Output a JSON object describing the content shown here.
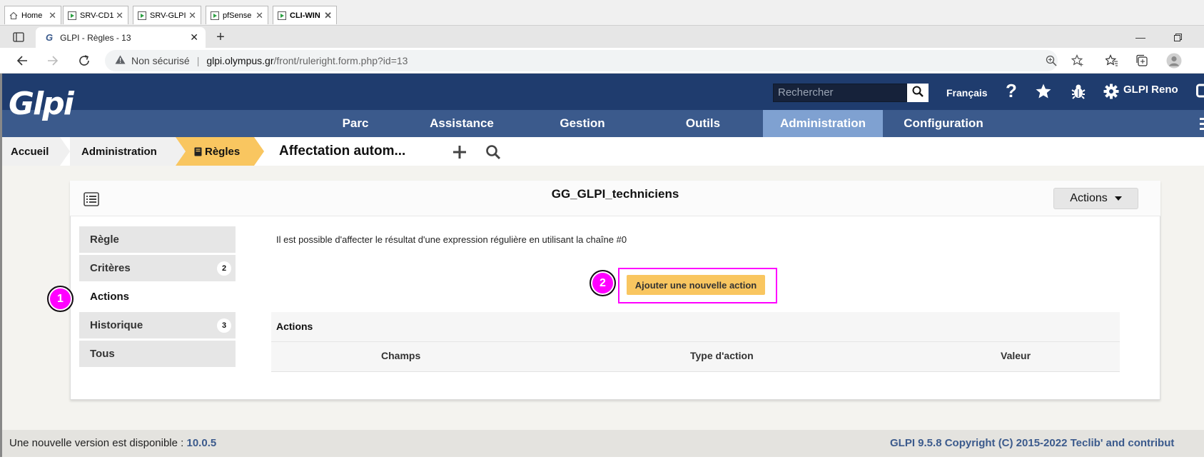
{
  "vm_tabs": [
    {
      "label": "Home",
      "icon": "home-icon"
    },
    {
      "label": "SRV-CD1",
      "icon": "vm-icon"
    },
    {
      "label": "SRV-GLPI",
      "icon": "vm-icon"
    },
    {
      "label": "pfSense",
      "icon": "vm-icon"
    },
    {
      "label": "CLI-WIN",
      "icon": "vm-icon",
      "active": true
    }
  ],
  "browser": {
    "tab_title": "GLPI - Règles - 13",
    "address": {
      "security_label": "Non sécurisé",
      "host": "glpi.olympus.gr",
      "path": "/front/ruleright.form.php?id=13"
    }
  },
  "glpi": {
    "logo": "Glpi",
    "search_placeholder": "Rechercher",
    "language": "Français",
    "user": "GLPI Reno",
    "nav": [
      "Parc",
      "Assistance",
      "Gestion",
      "Outils",
      "Administration",
      "Configuration"
    ],
    "active_nav": "Administration",
    "breadcrumb": [
      "Accueil",
      "Administration",
      "Règles"
    ],
    "page_title": "Affectation autom...",
    "colors": {
      "header_dark": "#1f3c6e",
      "nav": "#3b5a8c",
      "nav_active": "#7fa1d1",
      "crumb_active": "#f9c660",
      "highlight": "#ff00ff"
    }
  },
  "card": {
    "title": "GG_GLPI_techniciens",
    "actions_label": "Actions",
    "side_tabs": [
      {
        "label": "Règle"
      },
      {
        "label": "Critères",
        "count": "2"
      },
      {
        "label": "Actions",
        "selected": true
      },
      {
        "label": "Historique",
        "count": "3"
      },
      {
        "label": "Tous"
      }
    ],
    "info": "Il est possible d'affecter le résultat d'une expression régulière en utilisant la chaîne #0",
    "add_button": "Ajouter une nouvelle action",
    "table": {
      "caption": "Actions",
      "headers": [
        "Champs",
        "Type d'action",
        "Valeur"
      ]
    }
  },
  "markers": [
    "1",
    "2"
  ],
  "footer": {
    "new_version_label": "Une nouvelle version est disponible :",
    "new_version": "10.0.5",
    "copyright": "GLPI 9.5.8 Copyright (C) 2015-2022 Teclib' and contribut"
  }
}
